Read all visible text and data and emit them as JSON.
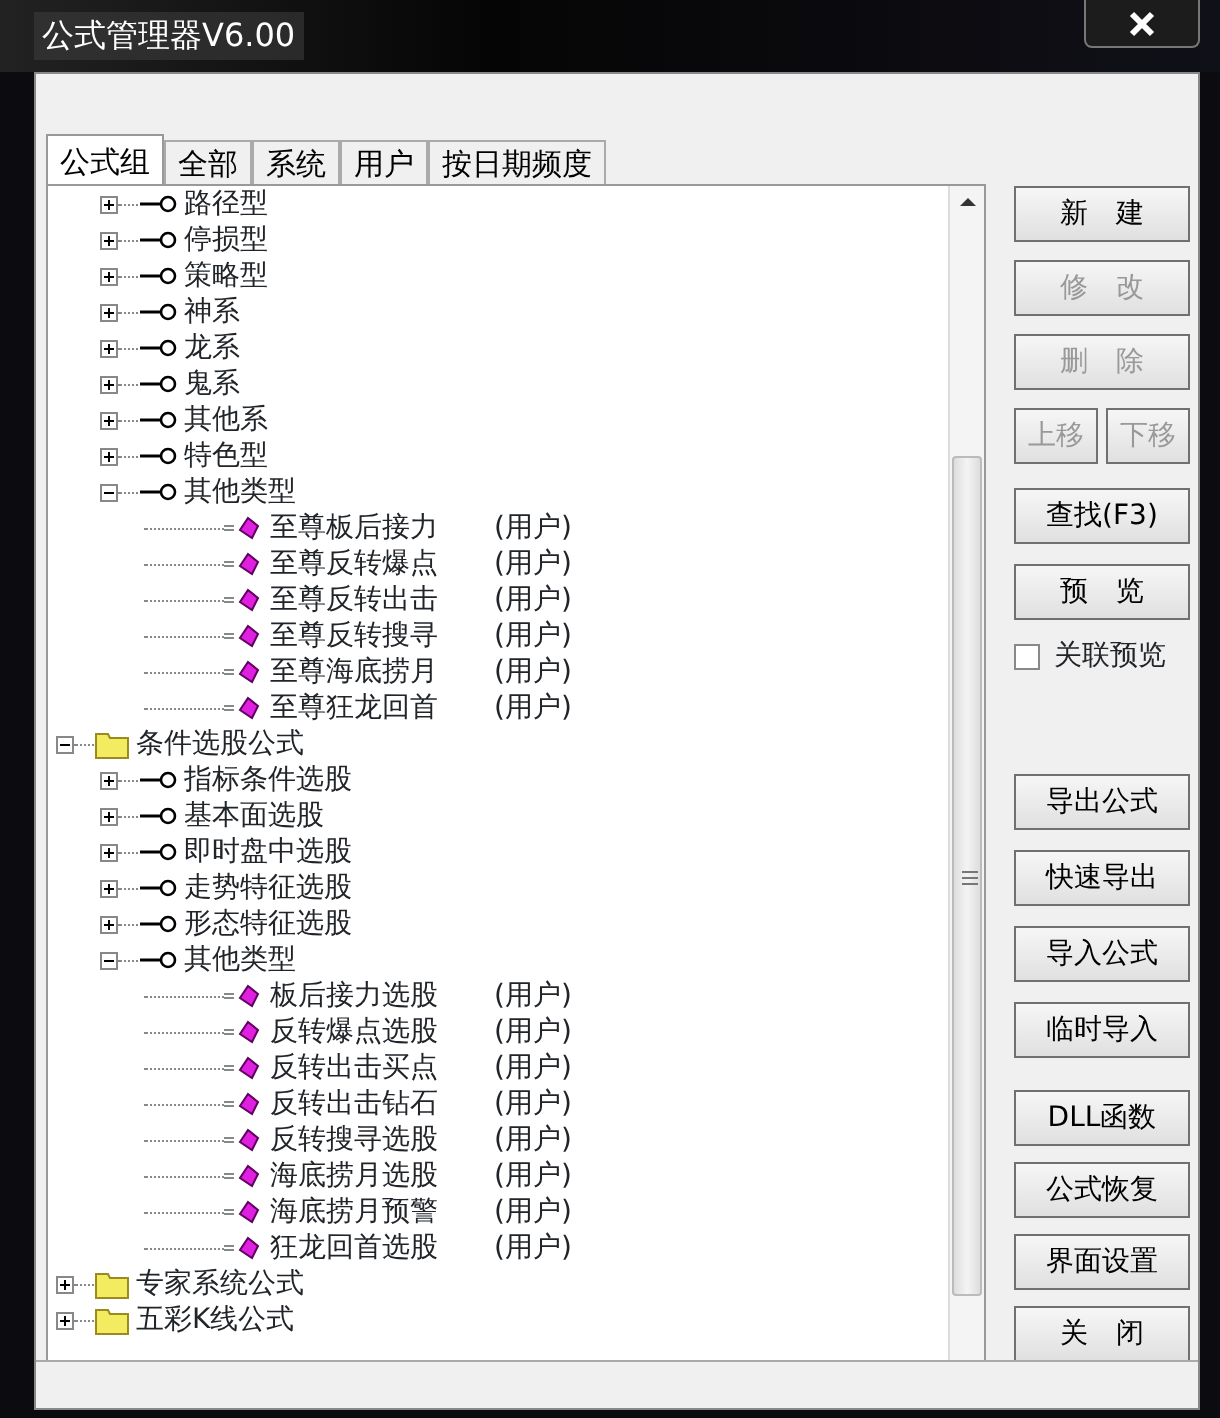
{
  "window": {
    "title": "公式管理器V6.00"
  },
  "tabs": [
    {
      "label": "公式组",
      "selected": true
    },
    {
      "label": "全部",
      "selected": false
    },
    {
      "label": "系统",
      "selected": false
    },
    {
      "label": "用户",
      "selected": false
    },
    {
      "label": "按日期频度",
      "selected": false
    }
  ],
  "tree": [
    {
      "kind": "folder",
      "children": [
        {
          "kind": "group",
          "label": "路径型",
          "expanded": false
        },
        {
          "kind": "group",
          "label": "停损型",
          "expanded": false
        },
        {
          "kind": "group",
          "label": "策略型",
          "expanded": false
        },
        {
          "kind": "group",
          "label": "神系",
          "expanded": false
        },
        {
          "kind": "group",
          "label": "龙系",
          "expanded": false
        },
        {
          "kind": "group",
          "label": "鬼系",
          "expanded": false
        },
        {
          "kind": "group",
          "label": "其他系",
          "expanded": false
        },
        {
          "kind": "group",
          "label": "特色型",
          "expanded": false
        },
        {
          "kind": "group",
          "label": "其他类型",
          "expanded": true,
          "children": [
            {
              "kind": "formula",
              "label": "至尊板后接力",
              "source": "(用户)"
            },
            {
              "kind": "formula",
              "label": "至尊反转爆点",
              "source": "(用户)"
            },
            {
              "kind": "formula",
              "label": "至尊反转出击",
              "source": "(用户)"
            },
            {
              "kind": "formula",
              "label": "至尊反转搜寻",
              "source": "(用户)"
            },
            {
              "kind": "formula",
              "label": "至尊海底捞月",
              "source": "(用户)"
            },
            {
              "kind": "formula",
              "label": "至尊狂龙回首",
              "source": "(用户)"
            }
          ]
        }
      ]
    },
    {
      "kind": "folder",
      "label": "条件选股公式",
      "expanded": true,
      "children": [
        {
          "kind": "group",
          "label": "指标条件选股",
          "expanded": false
        },
        {
          "kind": "group",
          "label": "基本面选股",
          "expanded": false
        },
        {
          "kind": "group",
          "label": "即时盘中选股",
          "expanded": false
        },
        {
          "kind": "group",
          "label": "走势特征选股",
          "expanded": false
        },
        {
          "kind": "group",
          "label": "形态特征选股",
          "expanded": false
        },
        {
          "kind": "group",
          "label": "其他类型",
          "expanded": true,
          "children": [
            {
              "kind": "formula",
              "label": "板后接力选股",
              "source": "(用户)"
            },
            {
              "kind": "formula",
              "label": "反转爆点选股",
              "source": "(用户)"
            },
            {
              "kind": "formula",
              "label": "反转出击买点",
              "source": "(用户)"
            },
            {
              "kind": "formula",
              "label": "反转出击钻石",
              "source": "(用户)"
            },
            {
              "kind": "formula",
              "label": "反转搜寻选股",
              "source": "(用户)"
            },
            {
              "kind": "formula",
              "label": "海底捞月选股",
              "source": "(用户)"
            },
            {
              "kind": "formula",
              "label": "海底捞月预警",
              "source": "(用户)"
            },
            {
              "kind": "formula",
              "label": "狂龙回首选股",
              "source": "(用户)"
            }
          ]
        }
      ]
    },
    {
      "kind": "folder",
      "label": "专家系统公式",
      "expanded": false
    },
    {
      "kind": "folder",
      "label": "五彩K线公式",
      "expanded": false
    }
  ],
  "edit_buttons": [
    {
      "label": "新　建",
      "disabled": false
    },
    {
      "label": "修　改",
      "disabled": true
    },
    {
      "label": "删　除",
      "disabled": true
    }
  ],
  "move_buttons": [
    {
      "label": "上移",
      "disabled": true
    },
    {
      "label": "下移",
      "disabled": true
    }
  ],
  "view_buttons": [
    {
      "label": "查找(F3)",
      "disabled": false
    },
    {
      "label": "预　览",
      "disabled": false
    }
  ],
  "preview_checkbox": {
    "label": "关联预览",
    "checked": false
  },
  "io_buttons": [
    {
      "label": "导出公式",
      "disabled": false
    },
    {
      "label": "快速导出",
      "disabled": false
    },
    {
      "label": "导入公式",
      "disabled": false
    },
    {
      "label": "临时导入",
      "disabled": false
    }
  ],
  "tool_buttons": [
    {
      "label": "DLL函数",
      "disabled": false
    },
    {
      "label": "公式恢复",
      "disabled": false
    },
    {
      "label": "界面设置",
      "disabled": false
    },
    {
      "label": "关　闭",
      "disabled": false
    }
  ]
}
